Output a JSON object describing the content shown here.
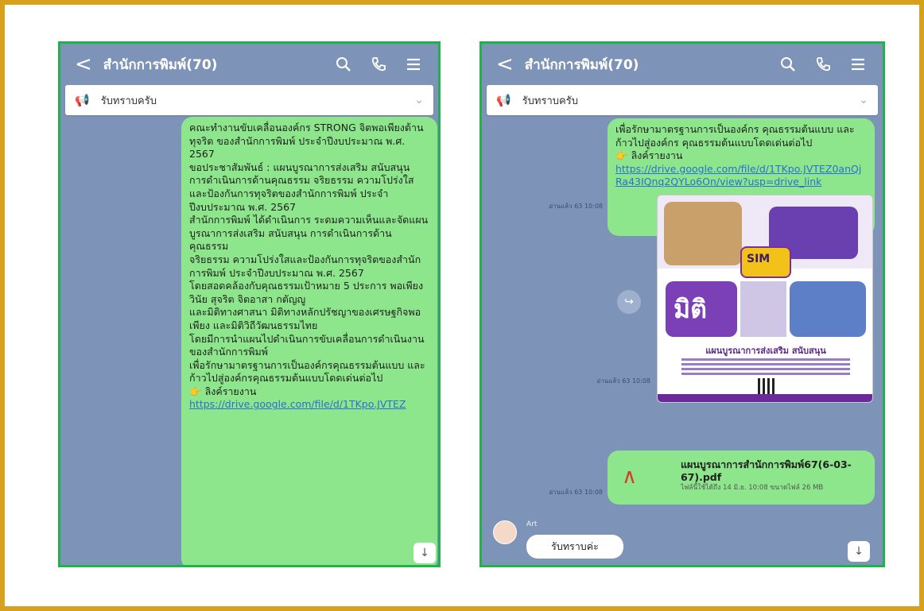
{
  "left_phone": {
    "back_glyph": "<",
    "title": "สำนักการพิมพ์(70)",
    "icons": [
      "search-icon",
      "phone-icon",
      "menu-icon"
    ],
    "announcement": "รับทราบครับ",
    "message_paragraphs": [
      "คณะทำงานขับเคลื่อนองค์กร STRONG จิตพอเพียงต้านทุจริต ของสำนักการพิมพ์ ประจำปีงบประมาณ พ.ศ. 2567",
      "ขอประชาสัมพันธ์ : แผนบูรณาการส่งเสริม สนับสนุน การดำเนินการด้านคุณธรรม จริยธรรม ความโปร่งใส และป้องกันการทุจริตของสำนักการพิมพ์ ประจำปีงบประมาณ พ.ศ. 2567",
      "สำนักการพิมพ์ ได้ดำเนินการ ระดมความเห็นและจัดแผนบูรณาการส่งเสริม สนับสนุน การดำเนินการด้านคุณธรรม",
      "จริยธรรม ความโปร่งใสและป้องกันการทุจริตของสำนักการพิมพ์ ประจำปีงบประมาณ พ.ศ. 2567",
      "โดยสอดคล้องกับคุณธรรมเป้าหมาย 5 ประการ พอเพียง วินัย สุจริต จิตอาสา กตัญญู",
      "และมิติทางศาสนา มิติทางหลักปรัชญาของเศรษฐกิจพอเพียง และมิติวิถีวัฒนธรรมไทย",
      "โดยมีการนำแผนไปดำเนินการขับเคลื่อนการดำเนินงานของสำนักการพิมพ์",
      "เพื่อรักษามาตรฐานการเป็นองค์กรคุณธรรมต้นแบบ และก้าวไปสู่องค์กรคุณธรรมต้นแบบโดดเด่นต่อไป"
    ],
    "link_label": "ลิงค์รายงาน",
    "link_url": "https://drive.google.com/file/d/1TKpo.JVTEZ",
    "scroll_glyph": "↓"
  },
  "right_phone": {
    "back_glyph": "<",
    "title": "สำนักการพิมพ์(70)",
    "icons": [
      "search-icon",
      "phone-icon",
      "menu-icon"
    ],
    "announcement": "รับทราบครับ",
    "top_message": "เพื่อรักษามาตรฐานการเป็นองค์กร คุณธรรมต้นแบบ และก้าวไปสู่องค์กร คุณธรรมต้นแบบโดดเด่นต่อไป",
    "link_label": "ลิงค์รายงาน",
    "link_url": "https://drive.google.com/file/d/1TKpo.JVTEZ0anQjRa43IQnq2QYLo6On/view?usp=drive_link",
    "stamp1": "อ่านแล้ว 63 10:08",
    "poster": {
      "mitti": "มิติ",
      "seal": "SIM",
      "heading": "แผนบูรณาการส่งเสริม สนับสนุน"
    },
    "stamp2": "อ่านแล้ว 63 10:08",
    "file_name": "แผนบูรณาการสำนักการพิมพ์67(6-03-67).pdf",
    "file_meta": "ไฟล์นี้ใช้ได้ถึง 14 มิ.ย. 10:08 ขนาดไฟล์ 26 MB",
    "stamp3": "อ่านแล้ว 63 10:08",
    "sender_name": "Art",
    "reply": "รับทราบค่ะ",
    "scroll_glyph": "↓"
  }
}
